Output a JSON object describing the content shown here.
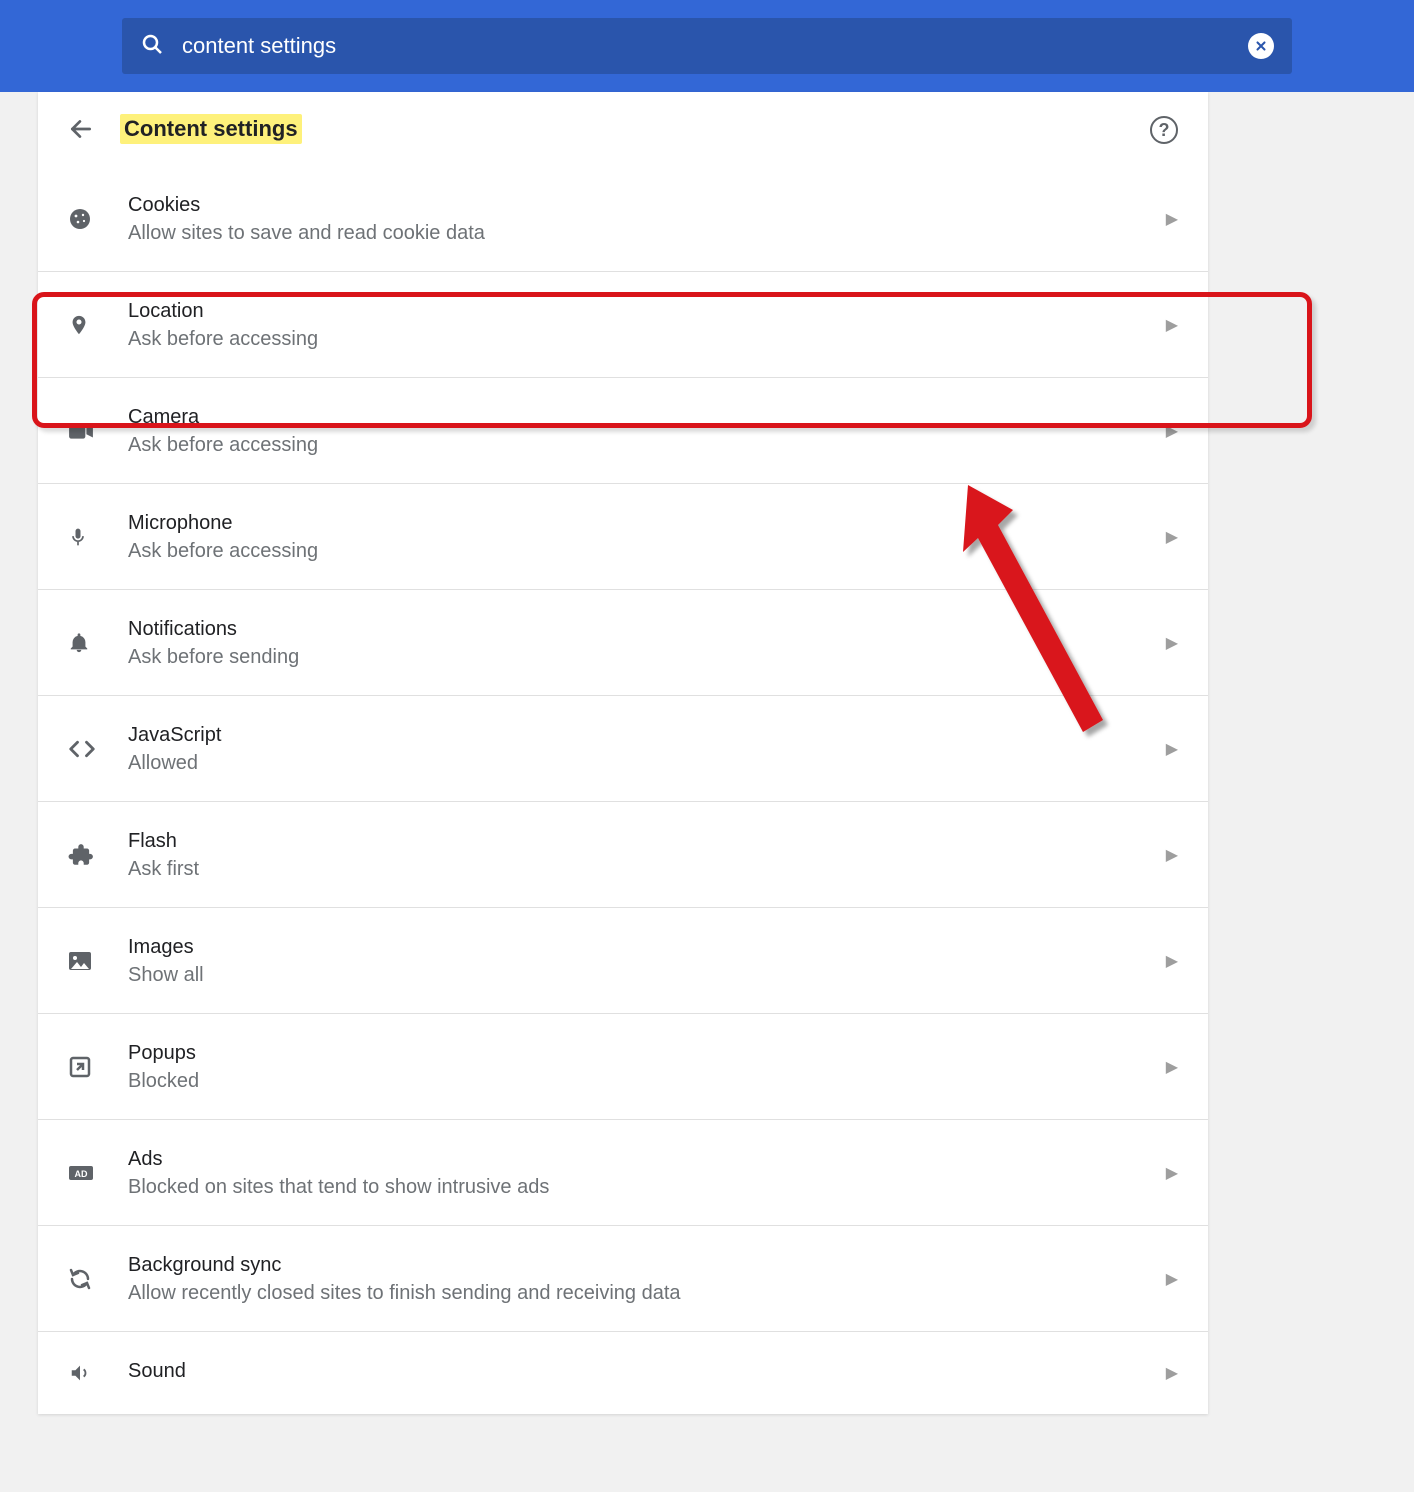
{
  "search": {
    "value": "content settings"
  },
  "page": {
    "title": "Content settings"
  },
  "rows": [
    {
      "title": "Cookies",
      "sub": "Allow sites to save and read cookie data"
    },
    {
      "title": "Location",
      "sub": "Ask before accessing"
    },
    {
      "title": "Camera",
      "sub": "Ask before accessing"
    },
    {
      "title": "Microphone",
      "sub": "Ask before accessing"
    },
    {
      "title": "Notifications",
      "sub": "Ask before sending"
    },
    {
      "title": "JavaScript",
      "sub": "Allowed"
    },
    {
      "title": "Flash",
      "sub": "Ask first"
    },
    {
      "title": "Images",
      "sub": "Show all"
    },
    {
      "title": "Popups",
      "sub": "Blocked"
    },
    {
      "title": "Ads",
      "sub": "Blocked on sites that tend to show intrusive ads"
    },
    {
      "title": "Background sync",
      "sub": "Allow recently closed sites to finish sending and receiving data"
    },
    {
      "title": "Sound",
      "sub": ""
    }
  ]
}
